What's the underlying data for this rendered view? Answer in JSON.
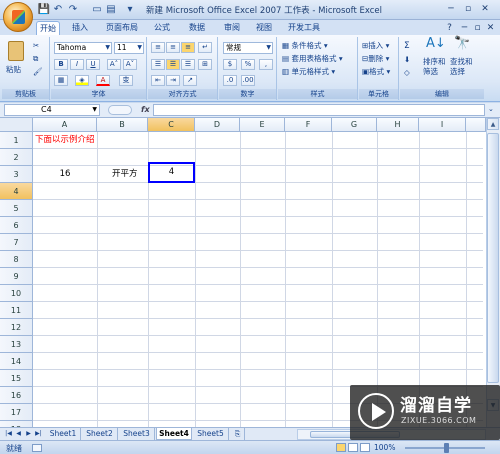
{
  "window": {
    "title": "新建 Microsoft Office Excel 2007 工作表 - Microsoft Excel",
    "minimize": "─",
    "restore": "▫",
    "close": "✕"
  },
  "quick_access": {
    "save": "💾",
    "undo": "↶",
    "redo": "↷",
    "customize": "▾"
  },
  "tabs": [
    {
      "label": "开始",
      "active": true
    },
    {
      "label": "插入"
    },
    {
      "label": "页面布局"
    },
    {
      "label": "公式"
    },
    {
      "label": "数据"
    },
    {
      "label": "审阅"
    },
    {
      "label": "视图"
    },
    {
      "label": "开发工具"
    }
  ],
  "tab_right": {
    "help": "?",
    "min": "─",
    "restore": "▫",
    "close": "✕"
  },
  "ribbon": {
    "clipboard": {
      "label": "剪贴板",
      "paste": "粘贴"
    },
    "font": {
      "label": "字体",
      "font_name": "Tahoma",
      "font_size": "11",
      "bold": "B",
      "italic": "I",
      "underline": "U",
      "grow": "A˄",
      "shrink": "A˅",
      "font_color": "A",
      "phonetic": "变"
    },
    "alignment": {
      "label": "对齐方式"
    },
    "number": {
      "label": "数字",
      "format": "常规",
      "percent": "%",
      "comma": ","
    },
    "styles": {
      "label": "样式",
      "conditional": "条件格式",
      "table": "套用表格格式",
      "cell": "单元格样式"
    },
    "cells": {
      "label": "单元格",
      "insert": "插入",
      "delete": "删除",
      "format": "格式"
    },
    "editing": {
      "label": "编辑",
      "sum": "Σ",
      "sort": "排序和",
      "sort2": "筛选",
      "find": "查找和",
      "find2": "选择"
    }
  },
  "formula_bar": {
    "name_box": "C4",
    "fx": "fx",
    "formula": ""
  },
  "columns": [
    "A",
    "B",
    "C",
    "D",
    "E",
    "F",
    "G",
    "H",
    "I"
  ],
  "rows": [
    "1",
    "2",
    "3",
    "4",
    "5",
    "6",
    "7",
    "8",
    "9",
    "10",
    "11",
    "12",
    "13",
    "14",
    "15",
    "16",
    "17",
    "18"
  ],
  "cells": {
    "a1": "下面以示例介绍",
    "a3": "16",
    "b3": "开平方",
    "c3": "4"
  },
  "colors": {
    "title_text": "#ff0000",
    "selection_border": "#0000ff"
  },
  "sheets": [
    {
      "label": "Sheet1"
    },
    {
      "label": "Sheet2"
    },
    {
      "label": "Sheet3"
    },
    {
      "label": "Sheet4",
      "active": true
    },
    {
      "label": "Sheet5"
    }
  ],
  "status": {
    "text": "就绪",
    "zoom": "100%"
  },
  "watermark": {
    "title": "溜溜自学",
    "subtitle": "ZIXUE.3066.COM"
  }
}
